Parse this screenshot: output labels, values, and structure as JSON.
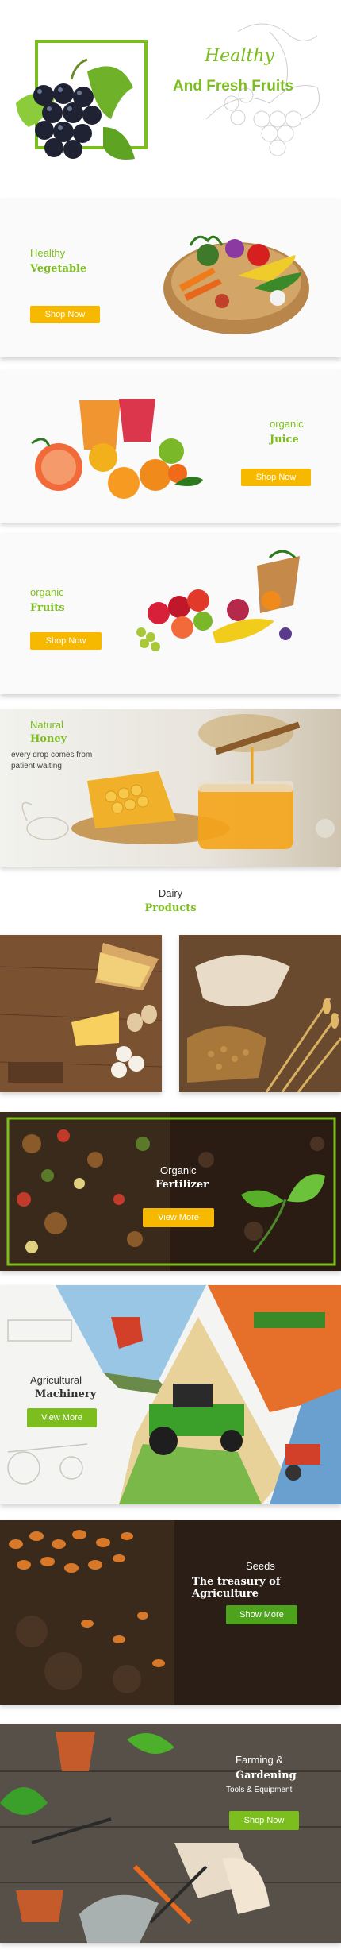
{
  "colors": {
    "green": "#7cbe1d",
    "yellow": "#f7b800",
    "dark_green": "#4ea31c",
    "white": "#ffffff"
  },
  "hero": {
    "line1": "Healthy",
    "line2": "And Fresh Fruits"
  },
  "vegetable": {
    "line1": "Healthy",
    "line2": "Vegetable",
    "button": "Shop Now"
  },
  "juice": {
    "line1": "organic",
    "line2": "Juice",
    "button": "Shop Now"
  },
  "fruits": {
    "line1": "organic",
    "line2": "Fruits",
    "button": "Shop Now"
  },
  "honey": {
    "line1": "Natural",
    "line2": "Honey",
    "line3": "every drop comes from",
    "line4": "patient waiting"
  },
  "dairy": {
    "line1": "Dairy",
    "line2": "Products"
  },
  "fertilizer": {
    "line1": "Organic",
    "line2": "Fertilizer",
    "button": "View More"
  },
  "machinery": {
    "line1": "Agricultural",
    "line2": "Machinery",
    "button": "View More"
  },
  "seeds": {
    "line1": "Seeds",
    "line2": "The treasury of Agriculture",
    "button": "Show More"
  },
  "farming": {
    "line1": "Farming &",
    "line2": "Gardening",
    "line3": "Tools & Equipment",
    "button": "Shop Now"
  }
}
